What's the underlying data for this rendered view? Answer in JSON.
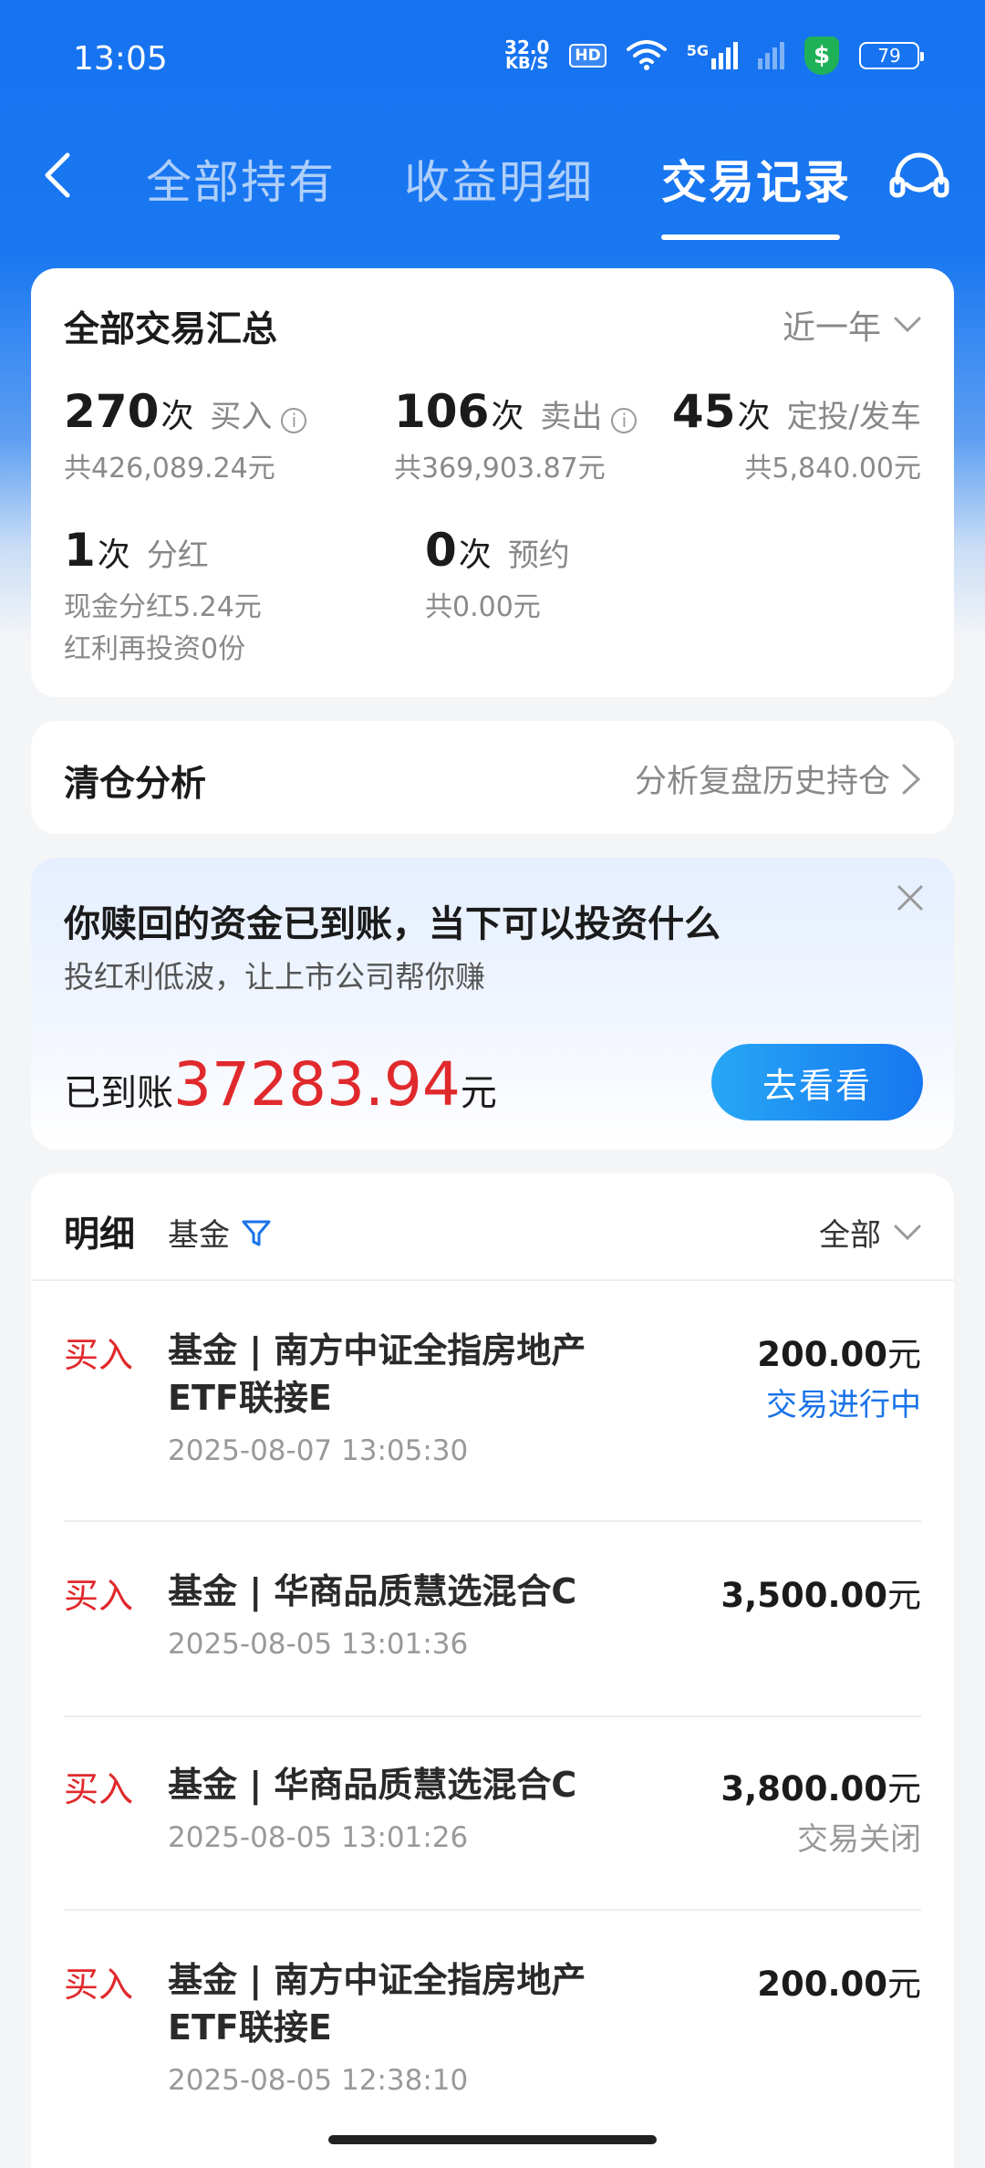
{
  "status_bar": {
    "time": "13:05",
    "net_speed_value": "32.0",
    "net_speed_unit": "KB/S",
    "hd_badge": "HD",
    "signal_label": "5G",
    "battery": "79",
    "shield_symbol": "$"
  },
  "nav": {
    "tabs": [
      {
        "label": "全部持有"
      },
      {
        "label": "收益明细"
      },
      {
        "label": "交易记录"
      }
    ],
    "active_tab_index": 2
  },
  "summary": {
    "title": "全部交易汇总",
    "period": "近一年",
    "stats": [
      {
        "count": "270",
        "unit": "次",
        "label": "买入",
        "sub": "共426,089.24元"
      },
      {
        "count": "106",
        "unit": "次",
        "label": "卖出",
        "sub": "共369,903.87元"
      },
      {
        "count": "45",
        "unit": "次",
        "label": "定投/发车",
        "sub": "共5,840.00元"
      },
      {
        "count": "1",
        "unit": "次",
        "label": "分红",
        "sub": "现金分红5.24元",
        "sub2": "红利再投资0份"
      },
      {
        "count": "0",
        "unit": "次",
        "label": "预约",
        "sub": "共0.00元"
      }
    ]
  },
  "clearance": {
    "title": "清仓分析",
    "link": "分析复盘历史持仓"
  },
  "promo": {
    "title": "你赎回的资金已到账，当下可以投资什么",
    "subtitle": "投红利低波，让上市公司帮你赚",
    "amount_label": "已到账",
    "amount": "37283.94",
    "amount_unit": "元",
    "button": "去看看"
  },
  "details": {
    "title": "明细",
    "filter_label": "基金",
    "scope": "全部",
    "transactions": [
      {
        "type": "买入",
        "name": "基金 | 南方中证全指房地产ETF联接E",
        "date": "2025-08-07 13:05:30",
        "amount": "200.00",
        "unit": "元",
        "status": "交易进行中",
        "status_color": "#1a73e8"
      },
      {
        "type": "买入",
        "name": "基金 | 华商品质慧选混合C",
        "date": "2025-08-05 13:01:36",
        "amount": "3,500.00",
        "unit": "元",
        "status": "",
        "status_color": "#999999"
      },
      {
        "type": "买入",
        "name": "基金 | 华商品质慧选混合C",
        "date": "2025-08-05 13:01:26",
        "amount": "3,800.00",
        "unit": "元",
        "status": "交易关闭",
        "status_color": "#999999"
      },
      {
        "type": "买入",
        "name": "基金 | 南方中证全指房地产ETF联接E",
        "date": "2025-08-05 12:38:10",
        "amount": "200.00",
        "unit": "元",
        "status": "",
        "status_color": "#999999"
      }
    ]
  },
  "colors": {
    "brand_blue": "#1672f0",
    "sell_red": "#e0292c",
    "in_progress_blue": "#1a73e8"
  }
}
